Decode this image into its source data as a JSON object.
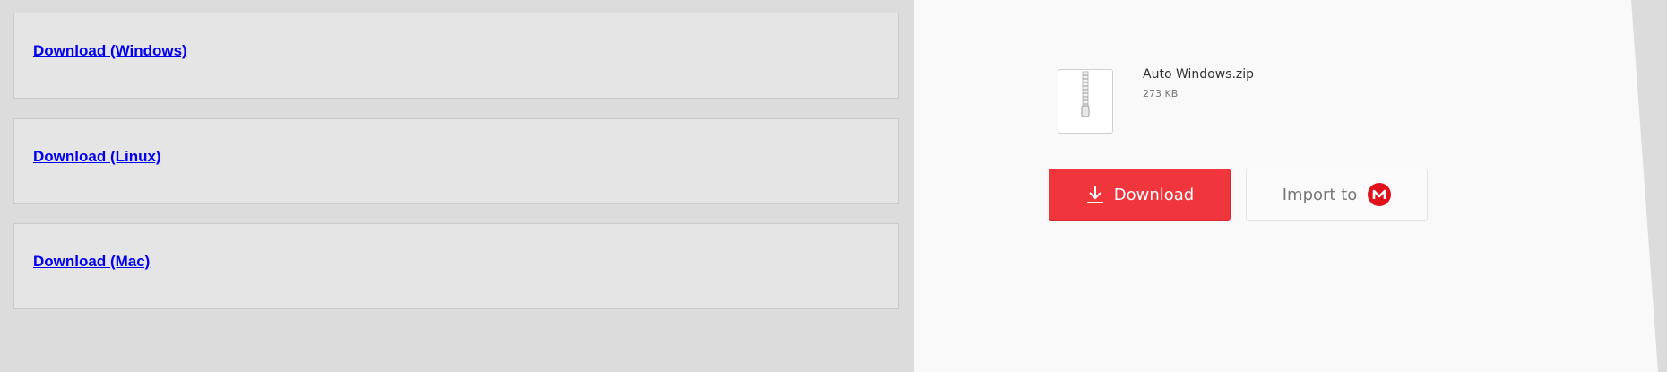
{
  "downloads": {
    "items": [
      {
        "label": "Download (Windows)"
      },
      {
        "label": "Download (Linux)"
      },
      {
        "label": "Download (Mac)"
      }
    ]
  },
  "file": {
    "name": "Auto Windows.zip",
    "size": "273 KB",
    "icon": "zip-file-icon"
  },
  "actions": {
    "download_label": "Download",
    "download_icon": "download-arrow-icon",
    "import_label": "Import to",
    "import_icon": "mega-logo-icon"
  },
  "colors": {
    "download_button": "#f0363c",
    "mega_brand": "#e0111b",
    "link": "#0000ee"
  }
}
